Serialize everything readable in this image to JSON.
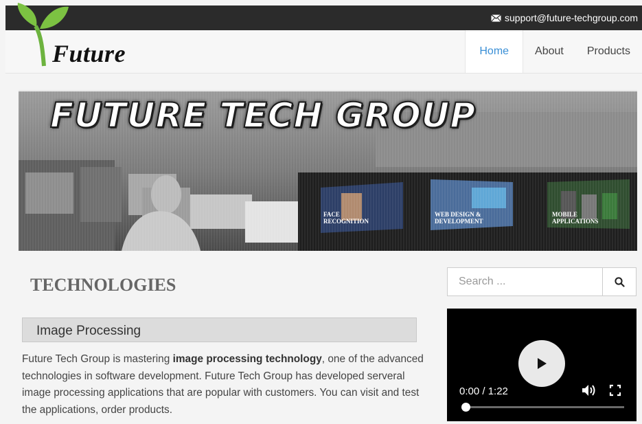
{
  "topbar": {
    "email": "support@future-techgroup.com",
    "icon": "mail-icon"
  },
  "brand": {
    "name": "Future"
  },
  "nav": [
    {
      "label": "Home",
      "active": true
    },
    {
      "label": "About",
      "active": false
    },
    {
      "label": "Products",
      "active": false
    }
  ],
  "banner": {
    "title": "FUTURE TECH GROUP",
    "tiles": [
      {
        "line1": "FACE",
        "line2": "RECOGNITION"
      },
      {
        "line1": "WEB DESIGN &",
        "line2": "DEVELOPMENT"
      },
      {
        "line1": "MOBILE",
        "line2": "APPLICATIONS"
      }
    ]
  },
  "main": {
    "section_title": "TECHNOLOGIES",
    "subheading": "Image Processing",
    "para_before": "Future Tech Group is mastering ",
    "para_bold": "image processing technology",
    "para_after": ", one of the advanced technologies in software development. Future Tech Group has developed serveral image processing applications that are popular with customers. You can visit and test the applications, order products."
  },
  "sidebar": {
    "search_placeholder": "Search ...",
    "search_icon": "search-icon"
  },
  "video": {
    "time": "0:00 / 1:22",
    "progress": 0
  },
  "colors": {
    "accent": "#3a8fd6",
    "topbar": "#2b2b2b",
    "logo_green": "#7cc242"
  }
}
